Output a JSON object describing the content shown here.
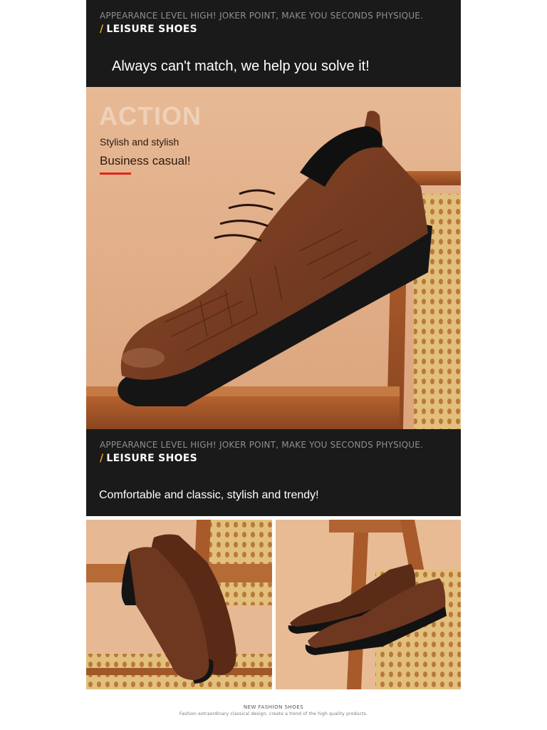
{
  "top_band": {
    "tagline": "APPEARANCE LEVEL HIGH! JOKER POINT, MAKE YOU SECONDS PHYSIQUE.",
    "category_slash": "/",
    "category": "LEISURE SHOES",
    "headline": "Always can't match, we help you solve it!"
  },
  "hero": {
    "watermark": "ACTION",
    "subtitle1": "Stylish and stylish",
    "subtitle2": "Business casual!",
    "accent_color": "#e0241b"
  },
  "middle_band": {
    "tagline": "APPEARANCE LEVEL HIGH! JOKER POINT, MAKE YOU SECONDS PHYSIQUE.",
    "category_slash": "/",
    "category": "LEISURE SHOES",
    "headline": "Comfortable and classic, stylish and trendy!"
  },
  "footer": {
    "line1": "NEW FASHION SHOES",
    "line2": "Fashion extraordinary classical design, create a trend of the high quality products."
  },
  "colors": {
    "band_bg": "#1a1a1a",
    "slash": "#f2a51a",
    "leather": "#6b3620",
    "backdrop": "#e9b896"
  }
}
